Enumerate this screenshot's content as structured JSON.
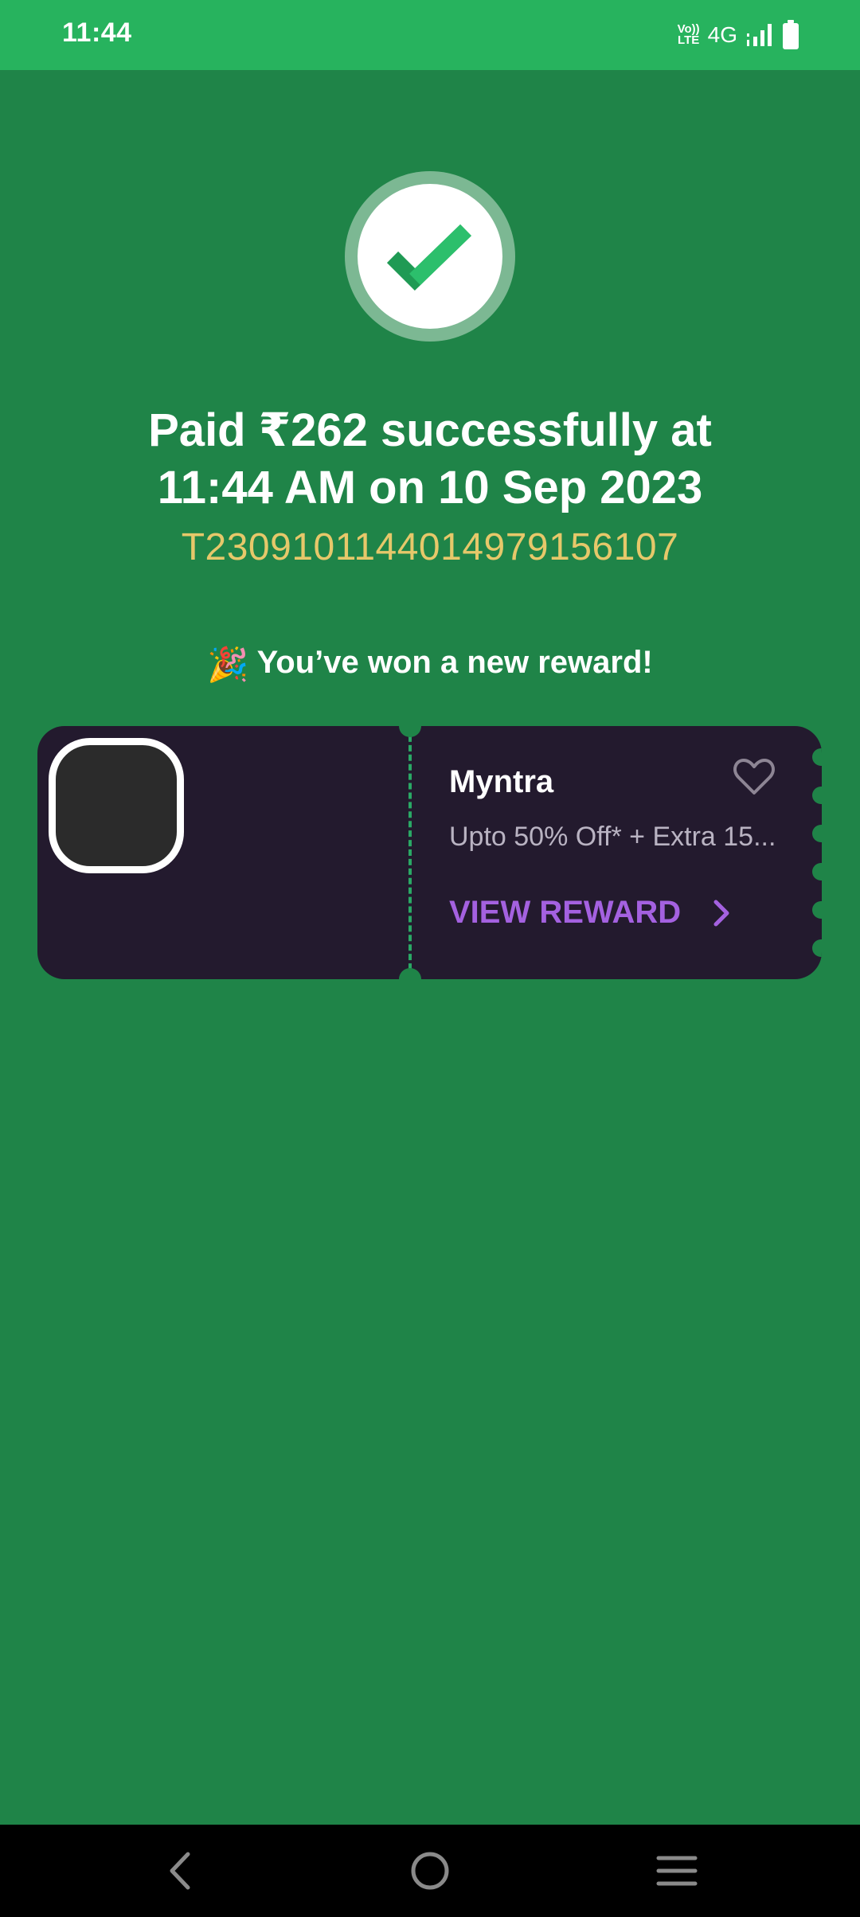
{
  "status_bar": {
    "time": "11:44",
    "volte_top": "Vo))",
    "volte_bottom": "LTE",
    "network": "4G",
    "icons": [
      "signal-icon",
      "battery-icon"
    ]
  },
  "payment": {
    "status_icon": "check-icon",
    "title_line1": "Paid ₹262 successfully at",
    "title_line2": "11:44 AM on 10 Sep 2023",
    "transaction_id": "T2309101144014979156107"
  },
  "reward": {
    "heading_icon": "🎉",
    "heading": "You’ve won a new reward!",
    "card": {
      "brand": "Myntra",
      "offer": "Upto 50% Off* + Extra 15...",
      "cta": "VIEW REWARD",
      "favorite_icon": "heart-icon",
      "cta_icon": "chevron-right-icon"
    }
  },
  "colors": {
    "background": "#1f8448",
    "status_bar": "#27b35e",
    "card": "#231a2e",
    "transaction_id": "#e6c86a",
    "cta": "#a461e0"
  },
  "nav": {
    "icons": [
      "back-icon",
      "home-icon",
      "recents-icon"
    ]
  }
}
